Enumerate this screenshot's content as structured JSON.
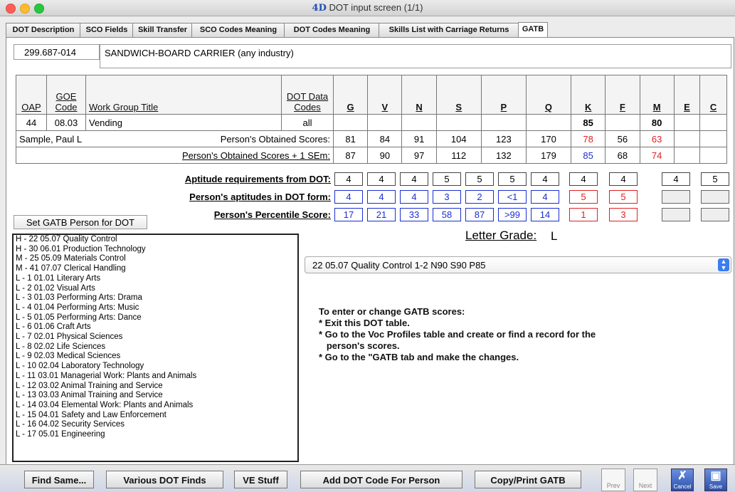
{
  "window": {
    "title": "DOT input screen (1/1)",
    "logo": "4D"
  },
  "tabs": [
    "DOT Description",
    "SCO Fields",
    "Skill Transfer",
    "SCO Codes Meaning",
    "DOT Codes Meaning",
    "Skills List with Carriage Returns",
    "GATB"
  ],
  "active_tab": "GATB",
  "dot": {
    "code": "299.687-014",
    "title": "SANDWICH-BOARD CARRIER (any industry)"
  },
  "table": {
    "headers": {
      "oap": "OAP",
      "goe": "GOE Code",
      "wgt": "Work Group Title",
      "dot_data": "DOT Data Codes",
      "aptitudes": [
        "G",
        "V",
        "N",
        "S",
        "P",
        "Q",
        "K",
        "F",
        "M",
        "E",
        "C"
      ]
    },
    "row1": {
      "oap": "44",
      "goe": "08.03",
      "wgt": "Vending",
      "dot_data": "all",
      "values": [
        "",
        "",
        "",
        "",
        "",
        "",
        "85",
        "",
        "80",
        "",
        ""
      ]
    },
    "row2": {
      "person": "Sample, Paul L",
      "label": "Person's Obtained Scores:",
      "values": [
        "81",
        "84",
        "91",
        "104",
        "123",
        "170",
        "78",
        "56",
        "63",
        "",
        ""
      ]
    },
    "row3": {
      "label": "Person's Obtained Scores + 1 SEm:",
      "values": [
        "87",
        "90",
        "97",
        "112",
        "132",
        "179",
        "85",
        "68",
        "74",
        "",
        ""
      ]
    }
  },
  "aptitude_rows": [
    {
      "label": "Aptitude requirements from DOT:",
      "values": [
        "4",
        "4",
        "4",
        "5",
        "5",
        "5",
        "4",
        "4",
        "4",
        "4",
        "5"
      ]
    },
    {
      "label": "Person's aptitudes in DOT form:",
      "values": [
        "4",
        "4",
        "4",
        "3",
        "2",
        "<1",
        "4",
        "5",
        "5",
        "",
        ""
      ]
    },
    {
      "label": "Person's Percentile Score:",
      "values": [
        "17",
        "21",
        "33",
        "58",
        "87",
        ">99",
        "14",
        "1",
        "3",
        "",
        ""
      ]
    }
  ],
  "set_button": "Set GATB Person for DOT",
  "list_items": [
    "H - 22  05.07  Quality Control",
    "H - 30  06.01  Production Technology",
    "M - 25  05.09  Materials Control",
    "M - 41  07.07  Clerical Handling",
    "L -  1  01.01  Literary Arts",
    "L -  2  01.02  Visual Arts",
    "L -  3  01.03  Performing Arts: Drama",
    "L -  4  01.04  Performing Arts: Music",
    "L -  5  01.05  Performing Arts: Dance",
    "L -  6  01.06  Craft Arts",
    "L -  7  02.01  Physical Sciences",
    "L -  8  02.02  Life Sciences",
    "L -  9  02.03  Medical Sciences",
    "L - 10  02.04  Laboratory Technology",
    "L - 11  03.01  Managerial Work: Plants and Animals",
    "L - 12  03.02  Animal Training and Service",
    "L - 13  03.03  Animal Training and Service",
    "L - 14  03.04  Elemental Work: Plants and Animals",
    "L - 15  04.01  Safety and Law Enforcement",
    "L - 16  04.02  Security Services",
    "L - 17  05.01  Engineering"
  ],
  "letter_grade": {
    "label": "Letter Grade:",
    "value": "L"
  },
  "select_value": "22  05.07  Quality Control  1-2  N90 S90 P85",
  "instructions": [
    "To enter or change GATB scores:",
    "* Exit this DOT table.",
    "* Go to the Voc Profiles table and create or find a record for the",
    "   person's scores.",
    "* Go to the \"GATB tab and make the changes."
  ],
  "bottom_buttons": [
    "Find Same...",
    "Various DOT Finds",
    "VE Stuff",
    "Add DOT Code For Person",
    "Copy/Print GATB"
  ],
  "nav": {
    "prev": "Prev",
    "next": "Next",
    "cancel": "Cancel",
    "save": "Save"
  }
}
